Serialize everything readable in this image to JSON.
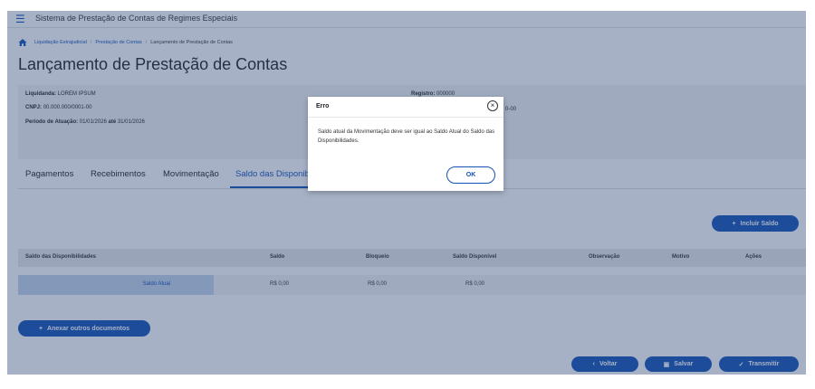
{
  "header": {
    "app_title": "Sistema de Prestação de Contas de Regimes Especiais"
  },
  "breadcrumb": {
    "items": [
      "Liquidação Extrajudicial",
      "Prestação de Contas",
      "Lançamento de Prestação de Contas"
    ]
  },
  "page": {
    "title": "Lançamento de Prestação de Contas"
  },
  "info": {
    "liquidanda_label": "Liquidanda:",
    "liquidanda_value": "LOREM IPSUM",
    "cnpj_label": "CNPJ:",
    "cnpj_value": "00.000.000/0001-00",
    "periodo_label": "Período de Atuação:",
    "periodo_start": "01/01/2026",
    "periodo_sep": "até",
    "periodo_end": "31/01/2026",
    "registro_label": "Registro:",
    "registro_value": "000000",
    "partial_value": "0-00"
  },
  "tabs": [
    {
      "label": "Pagamentos"
    },
    {
      "label": "Recebimentos"
    },
    {
      "label": "Movimentação"
    },
    {
      "label": "Saldo das Disponibili"
    }
  ],
  "actions": {
    "incluir_saldo": "Incluir Saldo",
    "anexar": "Anexar outros documentos",
    "voltar": "Voltar",
    "salvar": "Salvar",
    "transmitir": "Transmitir"
  },
  "table": {
    "headers": [
      "Saldo das Disponibilidades",
      "Saldo",
      "Bloqueio",
      "Saldo Disponível",
      "Observação",
      "Motivo",
      "Ações"
    ],
    "rows": [
      {
        "label": "Saldo Atual",
        "saldo": "R$ 0,00",
        "bloqueio": "R$ 0,00",
        "disponivel": "R$ 0,00"
      }
    ]
  },
  "modal": {
    "title": "Erro",
    "message": "Saldo atual da Movimentação deve ser igual ao Saldo Atual do Saldo das Disponibilidades.",
    "ok": "OK"
  },
  "colors": {
    "primary": "#1351b4",
    "overlay": "#2c4678"
  }
}
